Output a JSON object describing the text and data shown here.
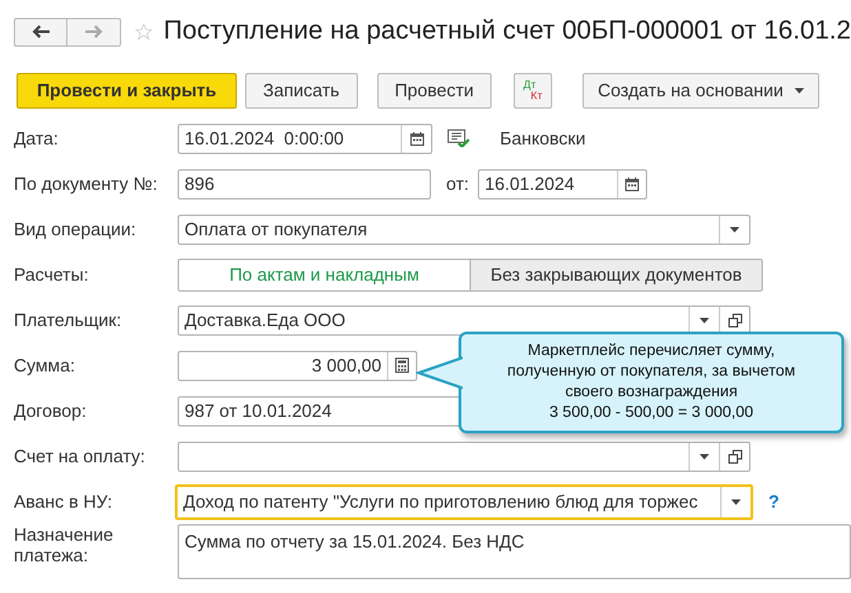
{
  "title": "Поступление на расчетный счет 00БП-000001 от 16.01.2",
  "toolbar": [
    {
      "label": "Провести и закрыть",
      "kind": "primary"
    },
    {
      "label": "Записать",
      "kind": "plain"
    },
    {
      "label": "Провести",
      "kind": "plain"
    },
    {
      "label": "Дт",
      "label2": "Кт",
      "kind": "dtkt"
    },
    {
      "label": "Создать на основании",
      "kind": "menu"
    }
  ],
  "right_label": "Банковски",
  "fields": [
    {
      "kind": "datetime",
      "label": "Дата:",
      "value": "16.01.2024  0:00:00"
    },
    {
      "kind": "docnum",
      "label": "По документу №:",
      "value": "896",
      "from_label": "от:",
      "from_value": "16.01.2024"
    },
    {
      "kind": "select",
      "label": "Вид операции:",
      "value": "Оплата от покупателя"
    },
    {
      "kind": "toggle",
      "label": "Расчеты:",
      "options": [
        {
          "label": "По актам и накладным",
          "selected": true
        },
        {
          "label": "Без закрывающих документов",
          "selected": false
        }
      ]
    },
    {
      "kind": "reference",
      "label": "Плательщик:",
      "value": "Доставка.Еда ООО"
    },
    {
      "kind": "amount",
      "label": "Сумма:",
      "value": "3 000,00"
    },
    {
      "kind": "reference",
      "label": "Договор:",
      "value": "987 от 10.01.2024"
    },
    {
      "kind": "reference",
      "label": "Счет на оплату:"
    },
    {
      "kind": "select",
      "label": "Аванс в НУ:",
      "value": "Доход по патенту \"Услуги по приготовлению блюд для торжес",
      "focused": true,
      "help": "?"
    },
    {
      "kind": "textarea",
      "label": "Назначение платежа:",
      "value": "Сумма по отчету за 15.01.2024. Без НДС"
    }
  ],
  "callout": {
    "lines": [
      "Маркетплейс перечисляет сумму,",
      "полученную от покупателя, за вычетом",
      "своего вознаграждения",
      "3 500,00 - 500,00 = 3 000,00"
    ]
  }
}
